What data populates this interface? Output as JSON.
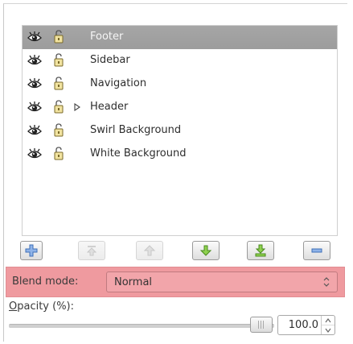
{
  "layers": {
    "items": [
      {
        "label": "Footer",
        "selected": true,
        "expandable": false
      },
      {
        "label": "Sidebar",
        "selected": false,
        "expandable": false
      },
      {
        "label": "Navigation",
        "selected": false,
        "expandable": false
      },
      {
        "label": "Header",
        "selected": false,
        "expandable": true
      },
      {
        "label": "Swirl Background",
        "selected": false,
        "expandable": false
      },
      {
        "label": "White Background",
        "selected": false,
        "expandable": false
      }
    ],
    "icons": {
      "visibility": "eye-icon",
      "lock": "lock-icon",
      "expander": "expander-arrow-icon"
    }
  },
  "toolbar": {
    "buttons": [
      {
        "name": "new-layer-button",
        "icon": "plus-icon",
        "enabled": true
      },
      {
        "name": "raise-to-top-button",
        "icon": "raise-to-top-icon",
        "enabled": false
      },
      {
        "name": "raise-layer-button",
        "icon": "arrow-up-icon",
        "enabled": false
      },
      {
        "name": "lower-layer-button",
        "icon": "arrow-down-icon",
        "enabled": true
      },
      {
        "name": "lower-to-bottom-button",
        "icon": "lower-to-bottom-icon",
        "enabled": true
      },
      {
        "name": "delete-layer-button",
        "icon": "minus-icon",
        "enabled": true
      }
    ]
  },
  "blend": {
    "label": "Blend mode:",
    "value": "Normal",
    "highlight_color": "#ef9a9f"
  },
  "opacity": {
    "label_mnemonic": "O",
    "label_rest": "pacity (%):",
    "value": "100.0",
    "fraction": 1.0
  },
  "colors": {
    "selected_row": "#a0a0a0",
    "accent_blue": "#4a78c2",
    "accent_green": "#5aa02c"
  }
}
